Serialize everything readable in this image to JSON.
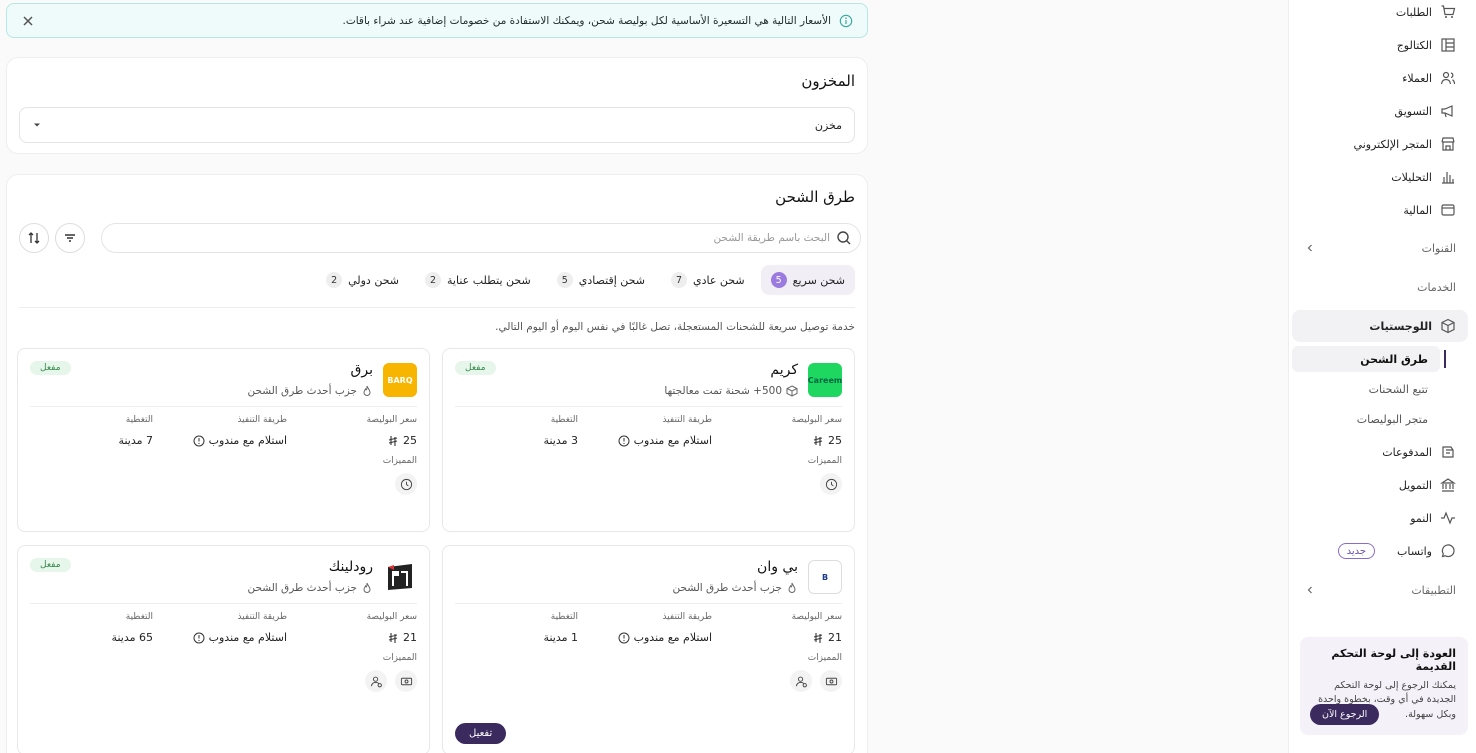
{
  "alert": {
    "text": "الأسعار التالية هي التسعيرة الأساسية لكل بوليصة شحن، ويمكنك الاستفادة من خصومات إضافية عند شراء باقات."
  },
  "warehouse": {
    "title": "المخزون",
    "select_value": "مخزن"
  },
  "shipping": {
    "title": "طرق الشحن",
    "search_placeholder": "البحث باسم طريقة الشحن",
    "tabs": [
      {
        "label": "شحن سريع",
        "count": "5"
      },
      {
        "label": "شحن عادي",
        "count": "7"
      },
      {
        "label": "شحن إقتصادي",
        "count": "5"
      },
      {
        "label": "شحن يتطلب عناية",
        "count": "2"
      },
      {
        "label": "شحن دولي",
        "count": "2"
      }
    ],
    "description": "خدمة توصيل سريعة للشحنات المستعجلة، تصل غالبًا في نفس اليوم أو اليوم التالي.",
    "labels": {
      "price": "سعر البوليصة",
      "method": "طريقة التنفيذ",
      "coverage": "التغطية",
      "features": "المميزات"
    },
    "carriers": [
      {
        "name": "كريم",
        "logo_text": "Careem",
        "subtitle": "500+ شحنة تمت معالجتها",
        "status": "مفعل",
        "price": "25",
        "method": "استلام مع مندوب",
        "coverage": "3 مدينة"
      },
      {
        "name": "برق",
        "logo_text": "BARQ",
        "subtitle": "جزب أحدث طرق الشحن",
        "status": "مفعل",
        "price": "25",
        "method": "استلام مع مندوب",
        "coverage": "7 مدينة"
      },
      {
        "name": "بي وان",
        "logo_text": "B",
        "subtitle": "جزب أحدث طرق الشحن",
        "status": "",
        "price": "21",
        "method": "استلام مع مندوب",
        "coverage": "1 مدينة",
        "action": "تفعيل"
      },
      {
        "name": "رودلينك",
        "logo_text": "R",
        "subtitle": "جزب أحدث طرق الشحن",
        "status": "مفعل",
        "price": "21",
        "method": "استلام مع مندوب",
        "coverage": "65 مدينة"
      }
    ]
  },
  "sidebar": {
    "items": [
      {
        "label": "الطلبات",
        "icon": "cart-icon"
      },
      {
        "label": "الكتالوج",
        "icon": "catalog-icon"
      },
      {
        "label": "العملاء",
        "icon": "users-icon"
      },
      {
        "label": "التسويق",
        "icon": "megaphone-icon"
      },
      {
        "label": "المتجر الإلكتروني",
        "icon": "store-icon"
      },
      {
        "label": "التحليلات",
        "icon": "analytics-icon"
      },
      {
        "label": "المالية",
        "icon": "wallet-icon"
      }
    ],
    "channels": "القنوات",
    "services": "الخدمات",
    "logistics": "اللوجستيات",
    "logistics_sub": [
      "طرق الشحن",
      "تتبع الشحنات",
      "متجر البوليصات"
    ],
    "items2": [
      {
        "label": "المدفوعات",
        "icon": "payments-icon"
      },
      {
        "label": "التمويل",
        "icon": "bank-icon"
      },
      {
        "label": "النمو",
        "icon": "growth-icon"
      },
      {
        "label": "واتساب",
        "icon": "whatsapp-icon",
        "badge": "جديد"
      }
    ],
    "apps": "التطبيقات",
    "promo": {
      "title": "العودة إلى لوحة التحكم القديمة",
      "text": "يمكنك الرجوع إلى لوحة التحكم الجديدة في أي وقت، بخطوة واحدة وبكل سهولة.",
      "button": "الرجوع الآن"
    }
  }
}
